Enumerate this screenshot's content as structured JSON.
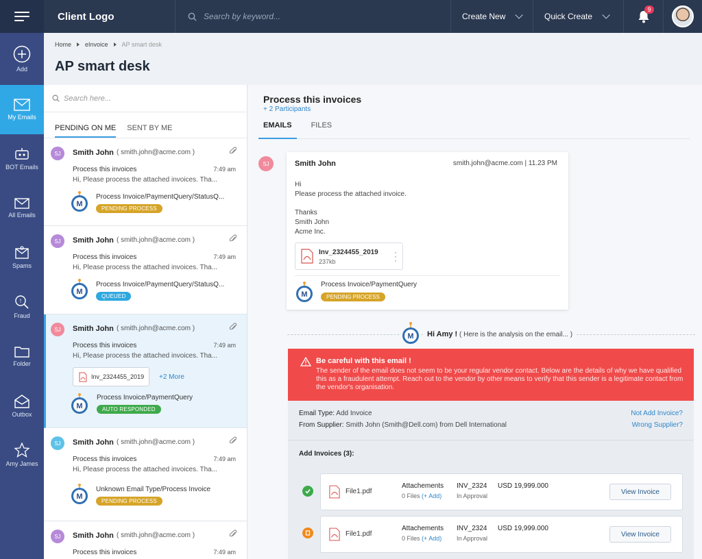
{
  "topbar": {
    "logo": "Client Logo",
    "search_placeholder": "Search by keyword...",
    "create_new": "Create New",
    "quick_create": "Quick Create",
    "notifications": "9"
  },
  "nav": {
    "add": "Add",
    "items": [
      "My Emails",
      "BOT Emails",
      "All Emails",
      "Spams",
      "Fraud",
      "Folder",
      "Outbox",
      "Amy James"
    ]
  },
  "breadcrumb": {
    "home": "Home",
    "einvoice": "eInvoice",
    "current": "AP smart desk"
  },
  "page_title": "AP smart desk",
  "list": {
    "search_placeholder": "Search here...",
    "tabs": [
      "PENDING ON ME",
      "SENT BY ME"
    ],
    "emails": [
      {
        "initials": "SJ",
        "name": "Smith John",
        "email": "( smith.john@acme.com )",
        "subject": "Process this invoices",
        "time": "7:49 am",
        "preview": "Hi, Please process the attached invoices. Tha...",
        "process": "Process Invoice/PaymentQuery/StatusQ...",
        "status": "PENDING PROCESS"
      },
      {
        "initials": "SJ",
        "name": "Smith John",
        "email": "( smith.john@acme.com )",
        "subject": "Process this invoices",
        "time": "7:49 am",
        "preview": "Hi, Please process the attached invoices. Tha...",
        "process": "Process Invoice/PaymentQuery/StatusQ...",
        "status": "QUEUED"
      },
      {
        "initials": "SJ",
        "name": "Smith John",
        "email": "( smith.john@acme.com )",
        "subject": "Process this invoices",
        "time": "7:49 am",
        "preview": "Hi, Please process the attached invoices. Tha...",
        "attachment": "Inv_2324455_2019",
        "more": "+2 More",
        "process": "Process Invoice/PaymentQuery",
        "status": "AUTO RESPONDED"
      },
      {
        "initials": "SJ",
        "name": "Smith John",
        "email": "( smith.john@acme.com )",
        "subject": "Process this invoices",
        "time": "7:49 am",
        "preview": "Hi, Please process the attached invoices. Tha...",
        "process": "Unknown Email Type/Process Invoice",
        "status": "PENDING PROCESS"
      },
      {
        "initials": "SJ",
        "name": "Smith John",
        "email": "( smith.john@acme.com )",
        "subject": "Process this invoices",
        "time": "7:49 am"
      }
    ]
  },
  "detail": {
    "title": "Process this invoices",
    "participants": "+ 2 Participants",
    "tabs": [
      "EMAILS",
      "FILES"
    ],
    "message": {
      "initials": "SJ",
      "from": "Smith John",
      "meta": "smith.john@acme.com  |  11.23 PM",
      "lines": [
        "Hi",
        "Please process the attached invoice.",
        "Thanks",
        "Smith John",
        "Acme Inc."
      ],
      "file_name": "Inv_2324455_2019",
      "file_size": "237kb",
      "process": "Process Invoice/PaymentQuery",
      "status": "PENDING PROCESS"
    },
    "amy": {
      "greeting": "Hi Amy !",
      "note": "( Here is the analysis on the email... )"
    },
    "warning": {
      "title": "Be careful with this email !",
      "text": "The sender of the email does not seem to be your regular vendor contact. Below are the details of why we have qualified this as a fraudulent attempt. Reach out to the vendor by other means to verify that this sender is a legitimate contact from the vendor's organisation."
    },
    "analysis": {
      "email_type_label": "Email Type:",
      "email_type": "Add Invoice",
      "supplier_label": "From Supplier:",
      "supplier": "Smith John (Smith@Dell.com) from Dell International",
      "not_add": "Not Add Invoice?",
      "wrong_supplier": "Wrong Supplier?",
      "add_invoices": "Add Invoices (3):",
      "invoices": [
        {
          "file": "File1.pdf",
          "att_label": "Attachements",
          "att_files": "0 Files",
          "att_add": "(+ Add)",
          "number": "INV_2324",
          "state": "In Approval",
          "amount": "USD 19,999.000",
          "button": "View Invoice"
        },
        {
          "file": "File1.pdf",
          "att_label": "Attachements",
          "att_files": "0 Files",
          "att_add": "(+ Add)",
          "number": "INV_2324",
          "state": "In Approval",
          "amount": "USD 19,999.000",
          "button": "View Invoice"
        }
      ]
    }
  },
  "colors": {
    "topbar": "#2a3850",
    "nav": "#394b82",
    "nav_active": "#31a8e6",
    "warning": "#f04a4a",
    "pending": "#d6a428",
    "queued": "#2ea8e0",
    "responded": "#3eaa4b"
  }
}
